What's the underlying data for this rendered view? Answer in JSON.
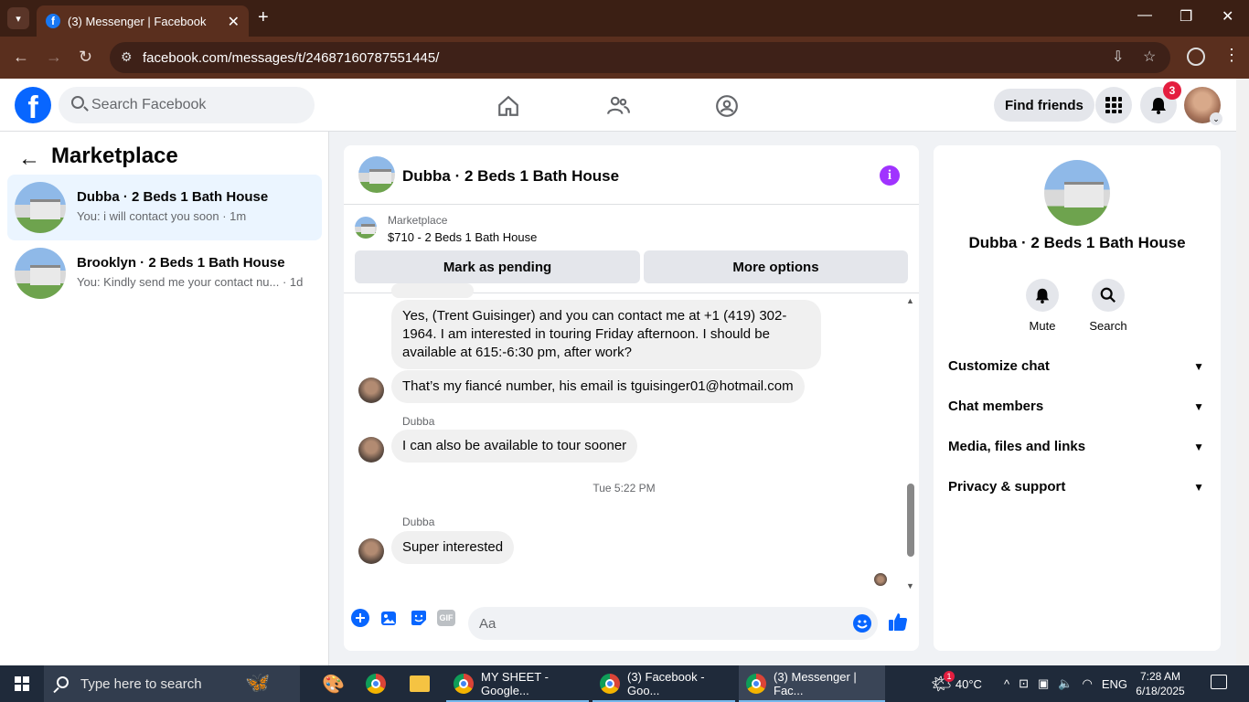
{
  "browser": {
    "tab_title": "(3) Messenger | Facebook",
    "url": "facebook.com/messages/t/24687160787551445/"
  },
  "fb": {
    "search_placeholder": "Search Facebook",
    "find_friends": "Find friends",
    "notif_count": "3"
  },
  "left": {
    "title": "Marketplace",
    "conversations": [
      {
        "title": "Dubba · 2 Beds 1 Bath House",
        "preview": "You: i will contact you soon · 1m"
      },
      {
        "title": "Brooklyn · 2 Beds 1 Bath House",
        "preview": "You: Kindly send me your contact nu... · 1d"
      }
    ]
  },
  "chat": {
    "title": "Dubba · 2 Beds 1 Bath House",
    "marketplace_label": "Marketplace",
    "listing": "$710 - 2 Beds 1 Bath House",
    "mark_pending": "Mark as pending",
    "more_options": "More options",
    "messages": [
      {
        "sender": "",
        "text": "Yes, (Trent Guisinger) and you can contact me at +1 (419) 302-1964. I am interested in touring Friday afternoon. I should be available at 615:-6:30 pm, after work?"
      },
      {
        "sender": "",
        "text": "That’s my fiancé number, his email is tguisinger01@hotmail.com"
      },
      {
        "sender": "Dubba",
        "text": "I can also be available to tour sooner"
      },
      {
        "sender": "Dubba",
        "text": "Super interested"
      }
    ],
    "timestamp": "Tue 5:22 PM",
    "input_placeholder": "Aa",
    "gif_label": "GIF"
  },
  "right": {
    "title": "Dubba · 2 Beds 1 Bath House",
    "mute": "Mute",
    "search": "Search",
    "sections": [
      "Customize chat",
      "Chat members",
      "Media, files and links",
      "Privacy & support"
    ]
  },
  "taskbar": {
    "search_placeholder": "Type here to search",
    "apps": [
      "MY SHEET - Google...",
      "(3) Facebook - Goo...",
      "(3) Messenger | Fac..."
    ],
    "weather": "40°C",
    "weather_badge": "1",
    "lang": "ENG",
    "time": "7:28 AM",
    "date": "6/18/2025"
  },
  "colors": {
    "fb_blue": "#0866ff",
    "info_purple": "#a033ff",
    "active_conv": "#ebf5ff"
  }
}
